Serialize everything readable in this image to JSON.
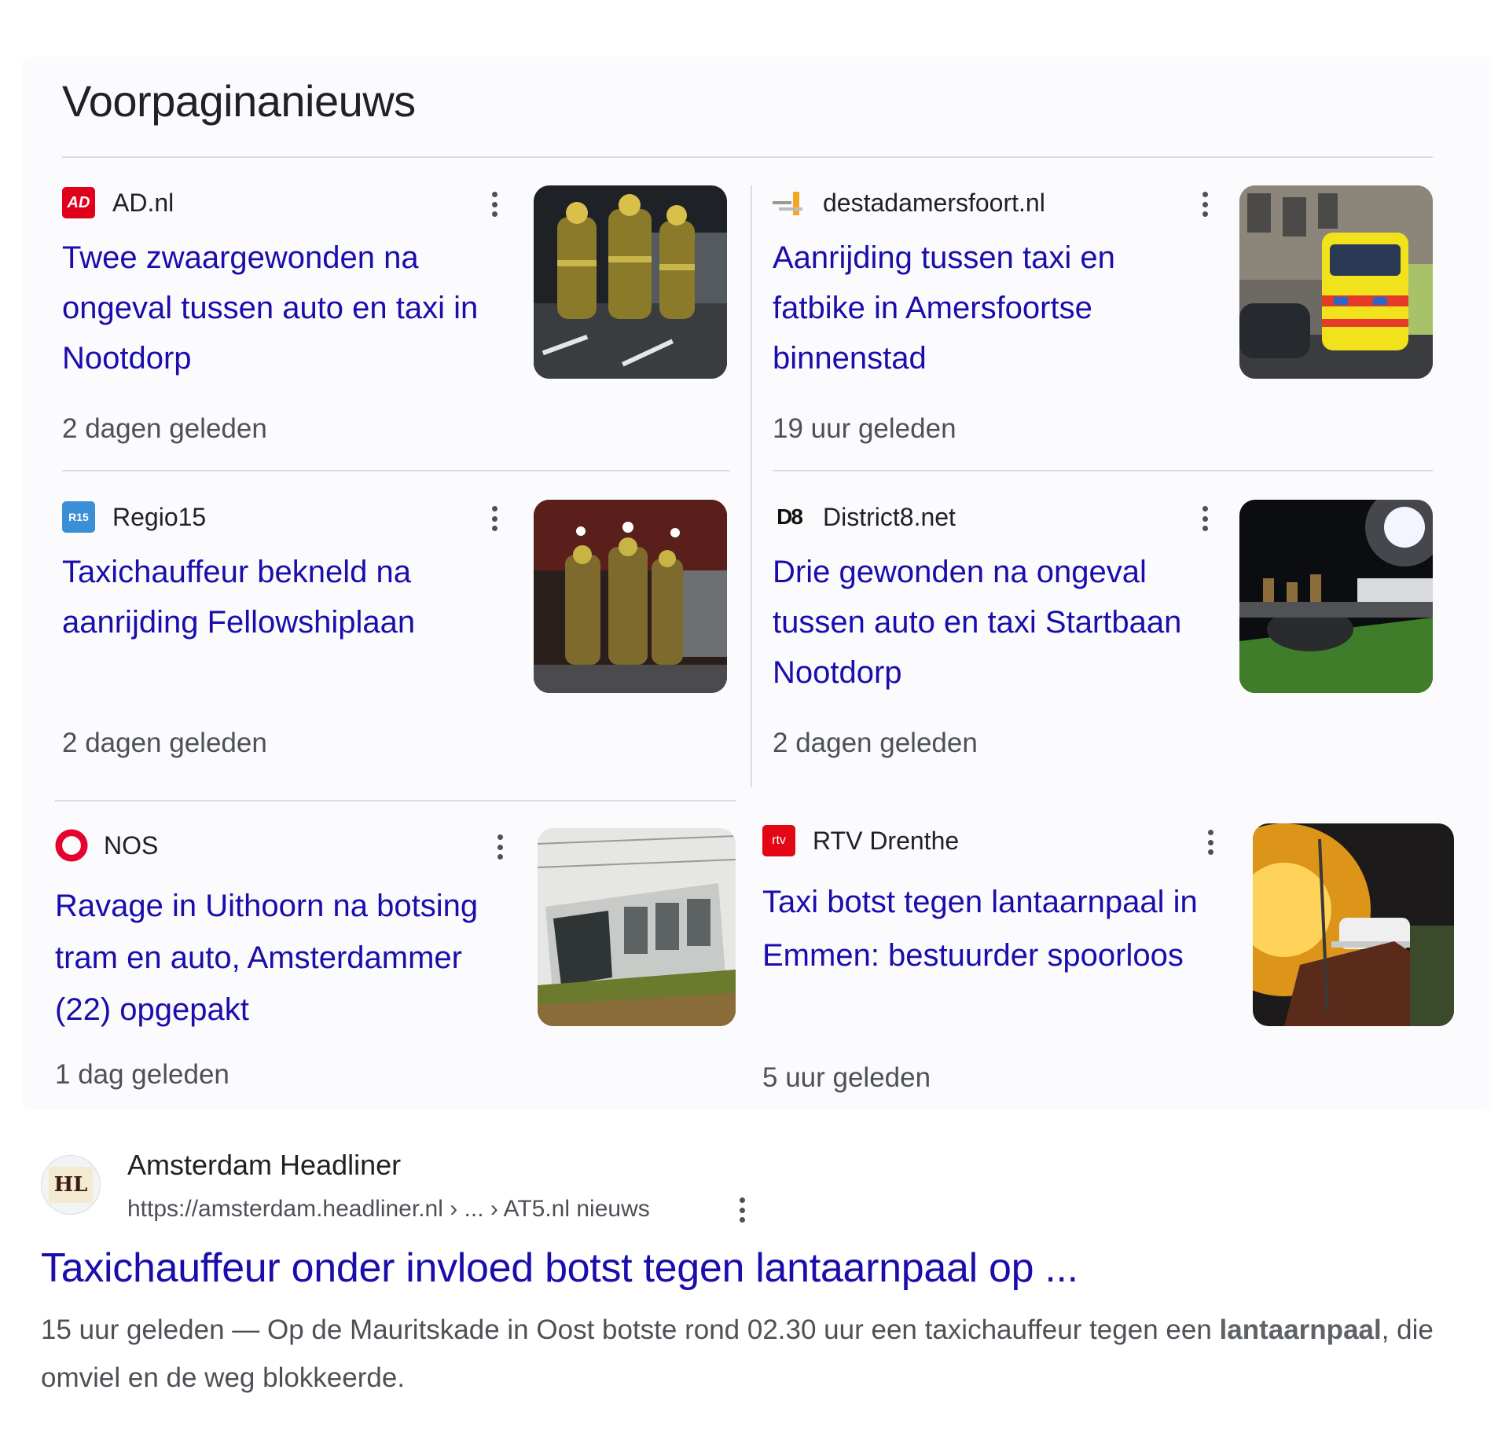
{
  "section_title": "Voorpaginanieuws",
  "cards": [
    {
      "source": "AD.nl",
      "logo_text": "AD",
      "logo_color": "#e1001a",
      "headline": "Twee zwaargewonden na ongeval tussen auto en taxi in Nootdorp",
      "time": "2 dagen geleden",
      "image": "firefighters-night-photo"
    },
    {
      "source": "destadamersfoort.nl",
      "logo_text": "",
      "logo_color": "#f5a623",
      "headline": "Aanrijding tussen taxi en fatbike in Amersfoortse binnenstad",
      "time": "19 uur geleden",
      "image": "ambulance-street-photo"
    },
    {
      "source": "Regio15",
      "logo_text": "R15",
      "logo_color": "#3b8fd6",
      "headline": "Taxichauffeur bekneld na aanrijding Fellowshiplaan",
      "time": "2 dagen geleden",
      "image": "rescue-workers-photo"
    },
    {
      "source": "District8.net",
      "logo_text": "D8",
      "logo_color": "#111111",
      "headline": "Drie gewonden na ongeval tussen auto en taxi Startbaan Nootdorp",
      "time": "2 dagen geleden",
      "image": "crash-site-floodlight-photo"
    },
    {
      "source": "NOS",
      "logo_text": "",
      "logo_color": "#e4032e",
      "headline": "Ravage in Uithoorn na botsing tram en auto, Amsterdammer (22) opgepakt",
      "time": "1 dag geleden",
      "image": "derailed-tram-photo"
    },
    {
      "source": "RTV Drenthe",
      "logo_text": "rtv",
      "logo_color": "#e30613",
      "headline": "Taxi botst tegen lantaarnpaal in Emmen: bestuurder spoorloos",
      "time": "5 uur geleden",
      "image": "emergency-lights-night-photo"
    }
  ],
  "organic": {
    "favicon_text": "HL",
    "site_name": "Amsterdam Headliner",
    "url": "https://amsterdam.headliner.nl › ... › AT5.nl nieuws",
    "title": "Taxichauffeur onder invloed botst tegen lantaarnpaal op ...",
    "snippet_prefix": "15 uur geleden — Op de Mauritskade in Oost botste rond 02.30 uur een taxichauffeur tegen een",
    "snippet_bold": "lantaarnpaal",
    "snippet_suffix": ", die omviel en de weg blokkeerde."
  },
  "colors": {
    "link": "#1a0dab",
    "muted": "#4d5156",
    "divider": "#dadce0"
  }
}
